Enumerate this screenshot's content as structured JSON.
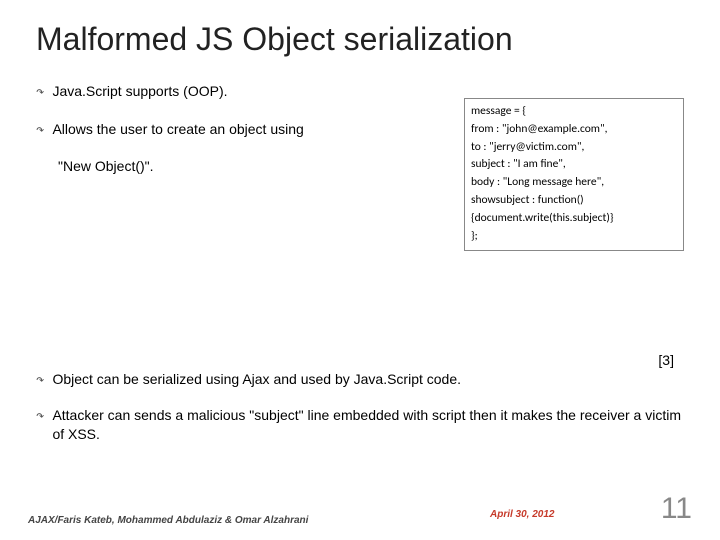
{
  "title": "Malformed JS Object serialization",
  "bullets_upper": [
    "Java.Script supports (OOP).",
    "Allows the user to create an object using"
  ],
  "indent_line": "\"New Object()\".",
  "code_lines": [
    "message = {",
    "from : \"john@example.com\",",
    "to : \"jerry@victim.com\",",
    "subject : \"I am fine\",",
    "body : \"Long message here\",",
    "showsubject : function()",
    "{document.write(this.subject)}",
    "};"
  ],
  "ref": "[3]",
  "bullets_lower": [
    "Object can be serialized using Ajax and used by Java.Script code.",
    "Attacker can sends a malicious \"subject\" line embedded with script then it makes the receiver a victim of XSS."
  ],
  "footer": {
    "authors": "AJAX/Faris Kateb, Mohammed Abdulaziz & Omar Alzahrani",
    "date": "April 30, 2012",
    "page": "11"
  }
}
